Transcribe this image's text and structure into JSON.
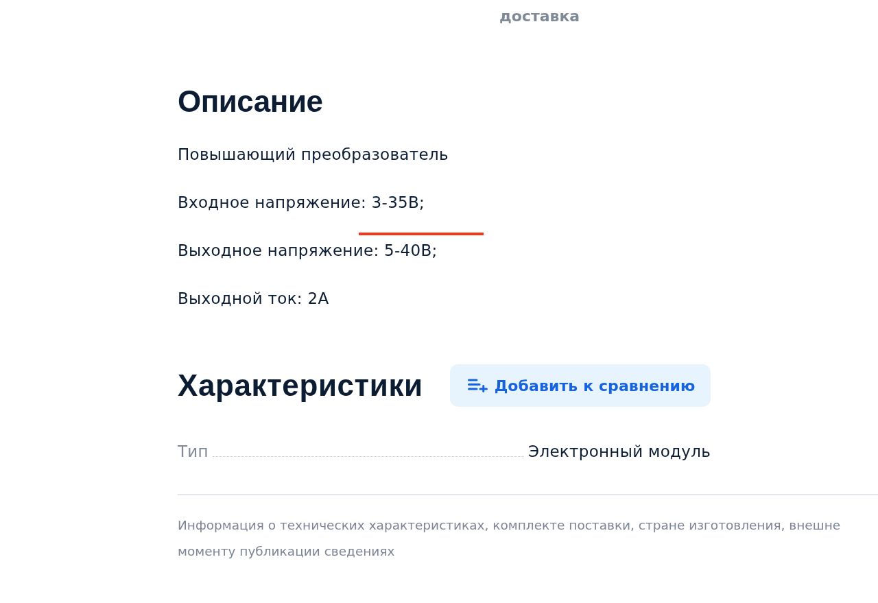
{
  "delivery_label": "доставка",
  "description": {
    "title": "Описание",
    "paragraphs": [
      "Повышающий преобразователь",
      "Входное напряжение: 3-35В;",
      "Выходное напряжение: 5-40В;",
      "Выходной ток: 2А"
    ]
  },
  "specifications": {
    "title": "Характеристики",
    "compare_button": {
      "label": "Добавить к сравнению"
    },
    "rows": [
      {
        "name": "Тип",
        "value": "Электронный модуль"
      }
    ]
  },
  "disclaimer_lines": [
    "Информация о технических характеристиках, комплекте поставки, стране изготовления, внешне",
    "моменту публикации сведениях"
  ]
}
